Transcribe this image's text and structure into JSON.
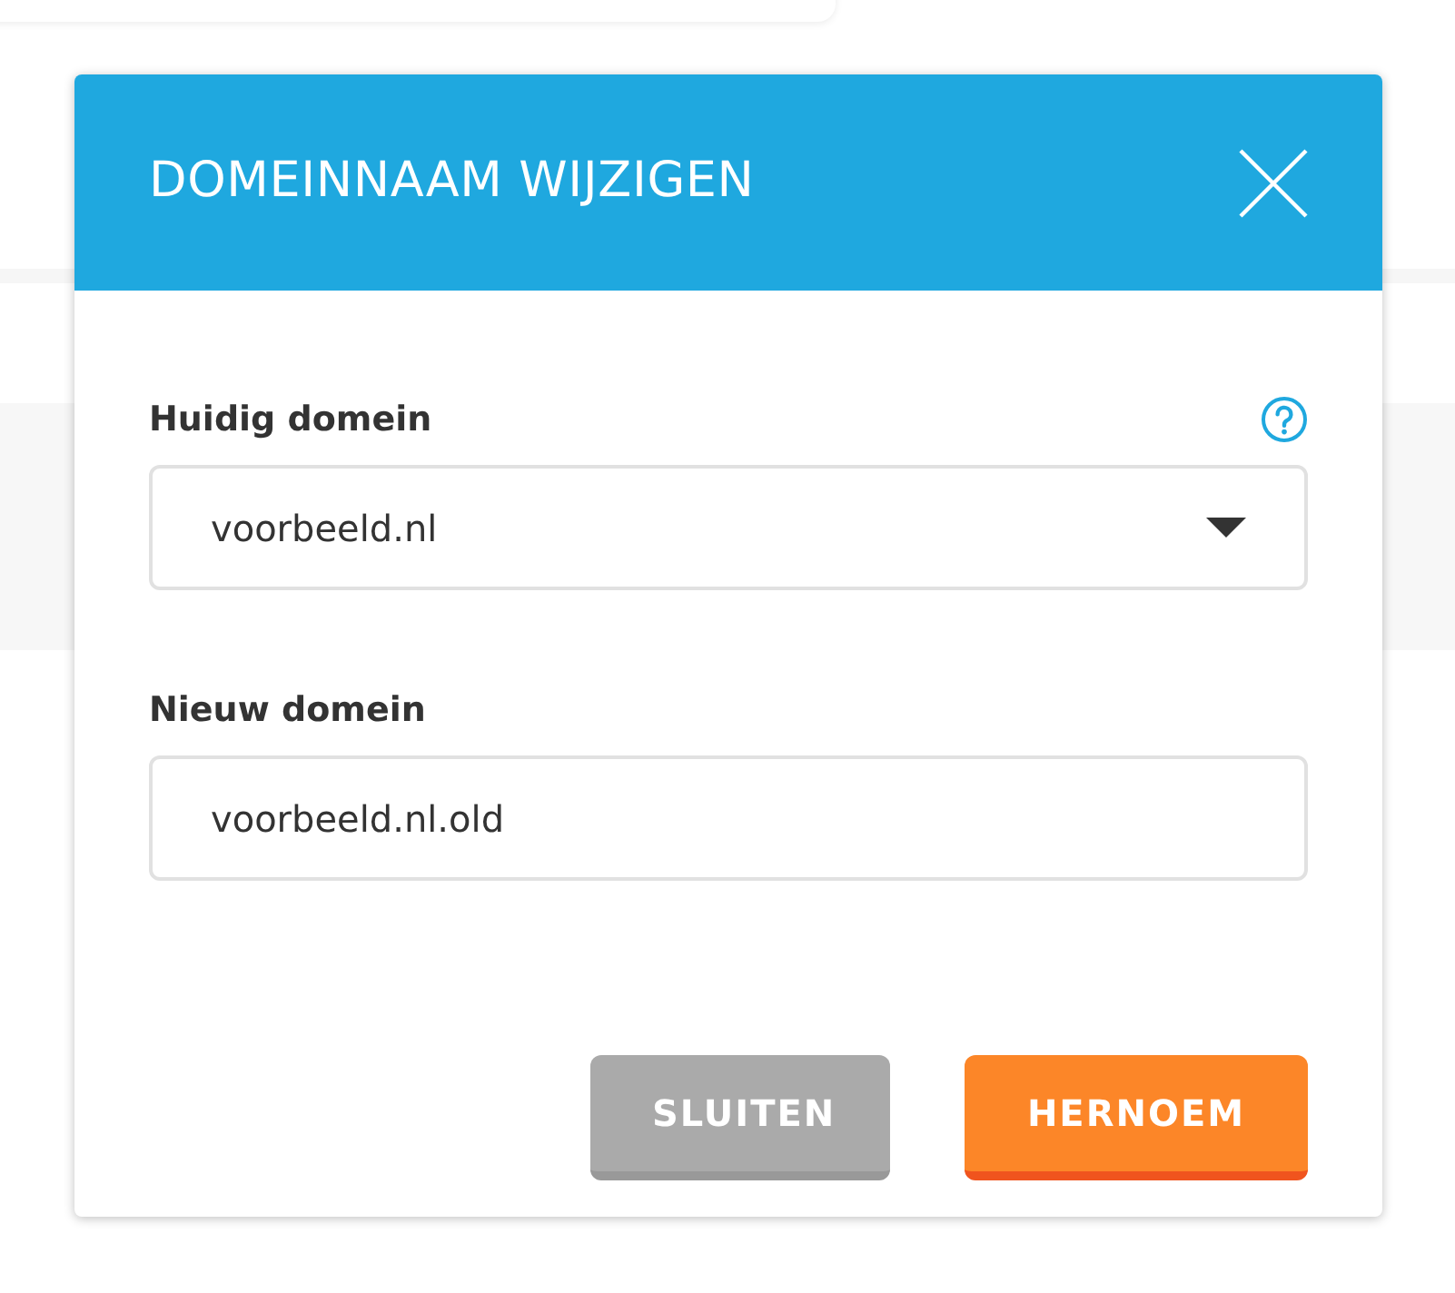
{
  "dialog": {
    "title": "DOMEINNAAM WIJZIGEN",
    "fields": [
      {
        "kind": "select",
        "label": "Huidig domein",
        "help": true,
        "value": "voorbeeld.nl"
      },
      {
        "kind": "text",
        "label": "Nieuw domein",
        "help": false,
        "value": "voorbeeld.nl.old"
      }
    ],
    "buttons": [
      {
        "label": "SLUITEN",
        "kind": "secondary"
      },
      {
        "label": "HERNOEM",
        "kind": "primary"
      }
    ]
  }
}
